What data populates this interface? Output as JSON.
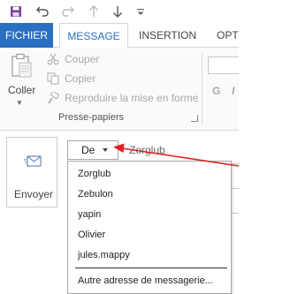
{
  "tabs": {
    "fichier": "FICHIER",
    "message": "MESSAGE",
    "insertion": "INSERTION",
    "options_partial": "OPTI"
  },
  "ribbon": {
    "coller_label": "Coller",
    "couper_label": "Couper",
    "copier_label": "Copier",
    "reproduire_label": "Reproduire la mise en forme",
    "group_label": "Presse-papiers",
    "bold_label": "G",
    "italic_label": "I"
  },
  "compose": {
    "send_label": "Envoyer",
    "from_button_label": "De",
    "from_value": "Zorglub"
  },
  "from_dropdown": {
    "accounts": [
      "Zorglub",
      "Zebulon",
      "yapin",
      "Olivier",
      "jules.mappy"
    ],
    "other_address_label": "Autre adresse de messagerie..."
  },
  "colors": {
    "accent": "#2b6fc2",
    "save_icon": "#7a3e9d",
    "annotation_arrow": "#e02020"
  },
  "icons": {
    "save": "save-icon",
    "undo": "undo-icon",
    "redo": "redo-icon",
    "up": "up-arrow-icon",
    "down": "down-arrow-icon",
    "customize": "customize-qat-icon",
    "paste": "clipboard-icon",
    "cut": "scissors-icon",
    "copy": "copy-icon",
    "format_painter": "format-painter-icon",
    "send": "send-envelope-icon"
  }
}
